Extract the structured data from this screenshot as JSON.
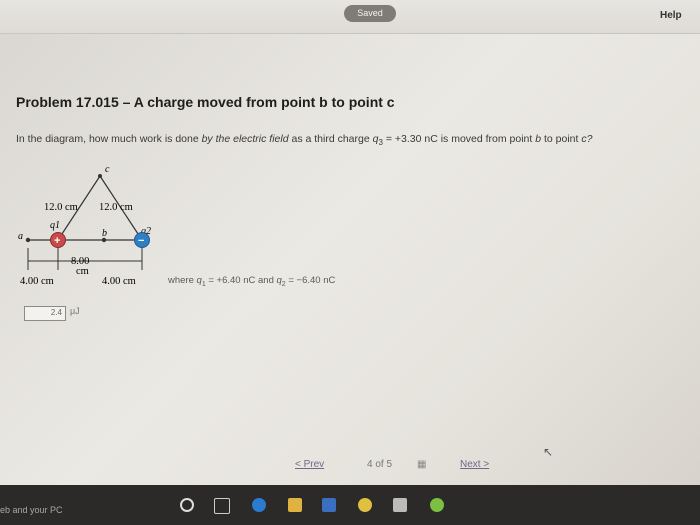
{
  "header": {
    "saved_label": "Saved",
    "help_label": "Help"
  },
  "problem": {
    "title": "Problem 17.015 – A charge moved from point b to point c",
    "question_start": "In the diagram, how much work is done ",
    "question_italic": "by the electric field",
    "question_mid": " as a third charge ",
    "q3_symbol": "q",
    "q3_sub": "3",
    "q3_value": " = +3.30 nC is moved from point ",
    "point_b": "b",
    "to_point": " to point ",
    "point_c": "c?"
  },
  "diagram": {
    "label_c": "c",
    "label_a": "a",
    "label_b": "b",
    "label_q1": "q1",
    "label_q2": "q2",
    "left_side": "12.0 cm",
    "right_side": "12.0 cm",
    "center_dist": "8.00",
    "center_unit": "cm",
    "left_dist": "4.00 cm",
    "right_dist": "4.00 cm",
    "q1_sign": "+",
    "q2_sign": "−"
  },
  "charges": {
    "where_prefix": "where ",
    "q1_symbol": "q",
    "q1_sub": "1",
    "q1_value": " = +6.40 nC and ",
    "q2_symbol": "q",
    "q2_sub": "2",
    "q2_value": " = −6.40 nC"
  },
  "answer": {
    "value": "2.4",
    "unit": "μJ"
  },
  "pager": {
    "prev_label": "< Prev",
    "count": "4 of 5",
    "grid_icon": "grid-icon",
    "next_label": "Next >"
  },
  "taskbar": {
    "search_text": "eb and your PC"
  },
  "colors": {
    "q1": "#c94a4a",
    "q2": "#2f7fc4",
    "taskbar": "#2c2a28"
  }
}
